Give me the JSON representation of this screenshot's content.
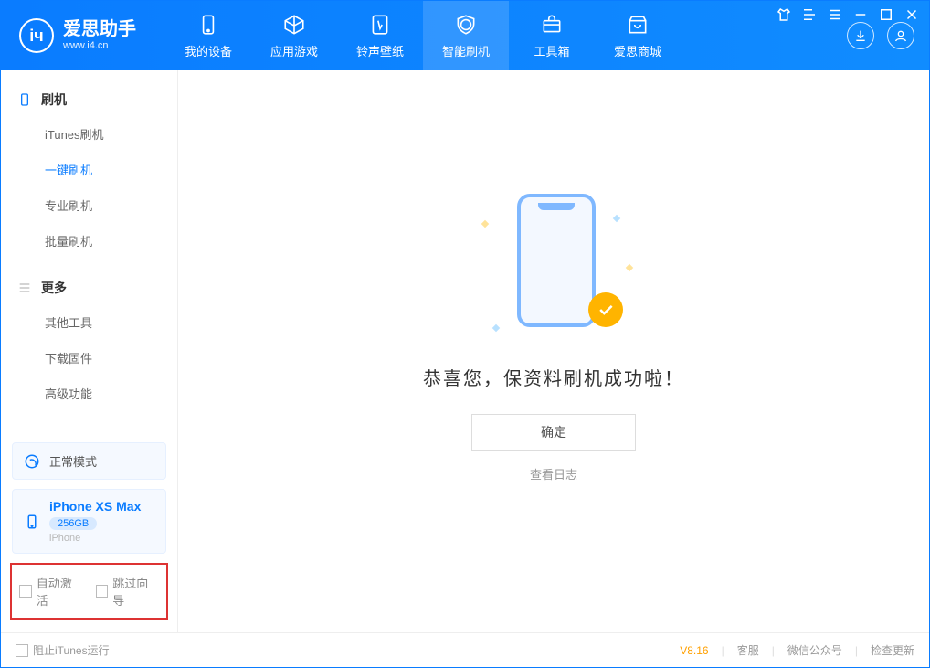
{
  "brand": {
    "name": "爱思助手",
    "url": "www.i4.cn"
  },
  "nav": {
    "items": [
      {
        "label": "我的设备"
      },
      {
        "label": "应用游戏"
      },
      {
        "label": "铃声壁纸"
      },
      {
        "label": "智能刷机"
      },
      {
        "label": "工具箱"
      },
      {
        "label": "爱思商城"
      }
    ]
  },
  "sidebar": {
    "section1": {
      "title": "刷机",
      "items": [
        {
          "label": "iTunes刷机"
        },
        {
          "label": "一键刷机"
        },
        {
          "label": "专业刷机"
        },
        {
          "label": "批量刷机"
        }
      ]
    },
    "section2": {
      "title": "更多",
      "items": [
        {
          "label": "其他工具"
        },
        {
          "label": "下载固件"
        },
        {
          "label": "高级功能"
        }
      ]
    },
    "mode": {
      "label": "正常模式"
    },
    "device": {
      "name": "iPhone XS Max",
      "capacity": "256GB",
      "type": "iPhone"
    }
  },
  "options": {
    "auto_activate": "自动激活",
    "skip_guide": "跳过向导"
  },
  "result": {
    "message": "恭喜您，保资料刷机成功啦！",
    "ok": "确定",
    "log": "查看日志"
  },
  "footer": {
    "block_itunes": "阻止iTunes运行",
    "version": "V8.16",
    "support": "客服",
    "wechat": "微信公众号",
    "check_update": "检查更新"
  }
}
